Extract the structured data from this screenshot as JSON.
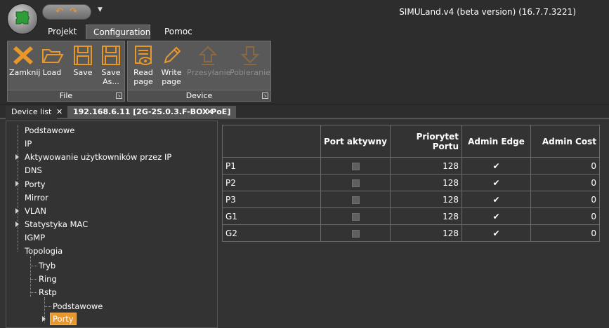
{
  "window": {
    "title": "SIMULand.v4 (beta version) (16.7.7.3221)",
    "quick_access": {
      "undo_icon": "undo-icon",
      "redo_icon": "redo-icon",
      "dropdown_icon": "chevron-down-icon"
    },
    "logo_icon": "puzzle-icon"
  },
  "ribbon": {
    "tabs": [
      "Projekt",
      "Configuration",
      "Pomoc"
    ],
    "active_tab": "Configuration",
    "groups": [
      {
        "label": "File",
        "buttons": [
          {
            "label": "Zamknij",
            "icon": "close-icon",
            "enabled": true
          },
          {
            "label": "Load",
            "icon": "folder-open-icon",
            "enabled": true
          },
          {
            "label": "Save",
            "icon": "save-icon",
            "enabled": true
          },
          {
            "label": "Save\nAs...",
            "line1": "Save",
            "line2": "As...",
            "icon": "save-as-icon",
            "enabled": true
          }
        ]
      },
      {
        "label": "Device",
        "buttons": [
          {
            "line1": "Read",
            "line2": "page",
            "icon": "read-page-icon",
            "enabled": true
          },
          {
            "line1": "Write",
            "line2": "page",
            "icon": "pencil-icon",
            "enabled": true
          },
          {
            "line1": "Przesyłanie",
            "icon": "upload-arrow-icon",
            "enabled": false
          },
          {
            "line1": "Pobieranie",
            "icon": "download-arrow-icon",
            "enabled": false
          }
        ]
      }
    ],
    "accent_color": "#e8982a"
  },
  "doc_tabs": [
    {
      "label": "Device list",
      "active": false
    },
    {
      "label": "192.168.6.11 [2G-2S.0.3.F-BOX-PoE]",
      "active": true
    }
  ],
  "close_glyph": "✕",
  "tree": {
    "items": [
      {
        "label": "Podstawowe",
        "level": 0,
        "expandable": false
      },
      {
        "label": "IP",
        "level": 0,
        "expandable": false
      },
      {
        "label": "Aktywowanie użytkowników przez IP",
        "level": 0,
        "expandable": true
      },
      {
        "label": "DNS",
        "level": 0,
        "expandable": false
      },
      {
        "label": "Porty",
        "level": 0,
        "expandable": true
      },
      {
        "label": "Mirror",
        "level": 0,
        "expandable": false
      },
      {
        "label": "VLAN",
        "level": 0,
        "expandable": true
      },
      {
        "label": "Statystyka MAC",
        "level": 0,
        "expandable": true
      },
      {
        "label": "IGMP",
        "level": 0,
        "expandable": false
      },
      {
        "label": "Topologia",
        "level": 0,
        "expandable": false
      },
      {
        "label": "Tryb",
        "level": 1,
        "expandable": false
      },
      {
        "label": "Ring",
        "level": 1,
        "expandable": false
      },
      {
        "label": "Rstp",
        "level": 1,
        "expandable": false
      },
      {
        "label": "Podstawowe",
        "level": 2,
        "expandable": false
      },
      {
        "label": "Porty",
        "level": 2,
        "expandable": true,
        "selected": true
      }
    ]
  },
  "grid": {
    "columns": [
      "",
      "Port aktywny",
      "Priorytet Portu",
      "Admin Edge",
      "Admin Cost"
    ],
    "col_priorytet_line1": "Priorytet",
    "col_priorytet_line2": "Portu",
    "rows": [
      {
        "port": "P1",
        "active": false,
        "priority": "128",
        "admin_edge": true,
        "admin_cost": "0"
      },
      {
        "port": "P2",
        "active": false,
        "priority": "128",
        "admin_edge": true,
        "admin_cost": "0"
      },
      {
        "port": "P3",
        "active": false,
        "priority": "128",
        "admin_edge": true,
        "admin_cost": "0"
      },
      {
        "port": "G1",
        "active": false,
        "priority": "128",
        "admin_edge": true,
        "admin_cost": "0"
      },
      {
        "port": "G2",
        "active": false,
        "priority": "128",
        "admin_edge": true,
        "admin_cost": "0"
      }
    ],
    "check_glyph": "✔"
  }
}
